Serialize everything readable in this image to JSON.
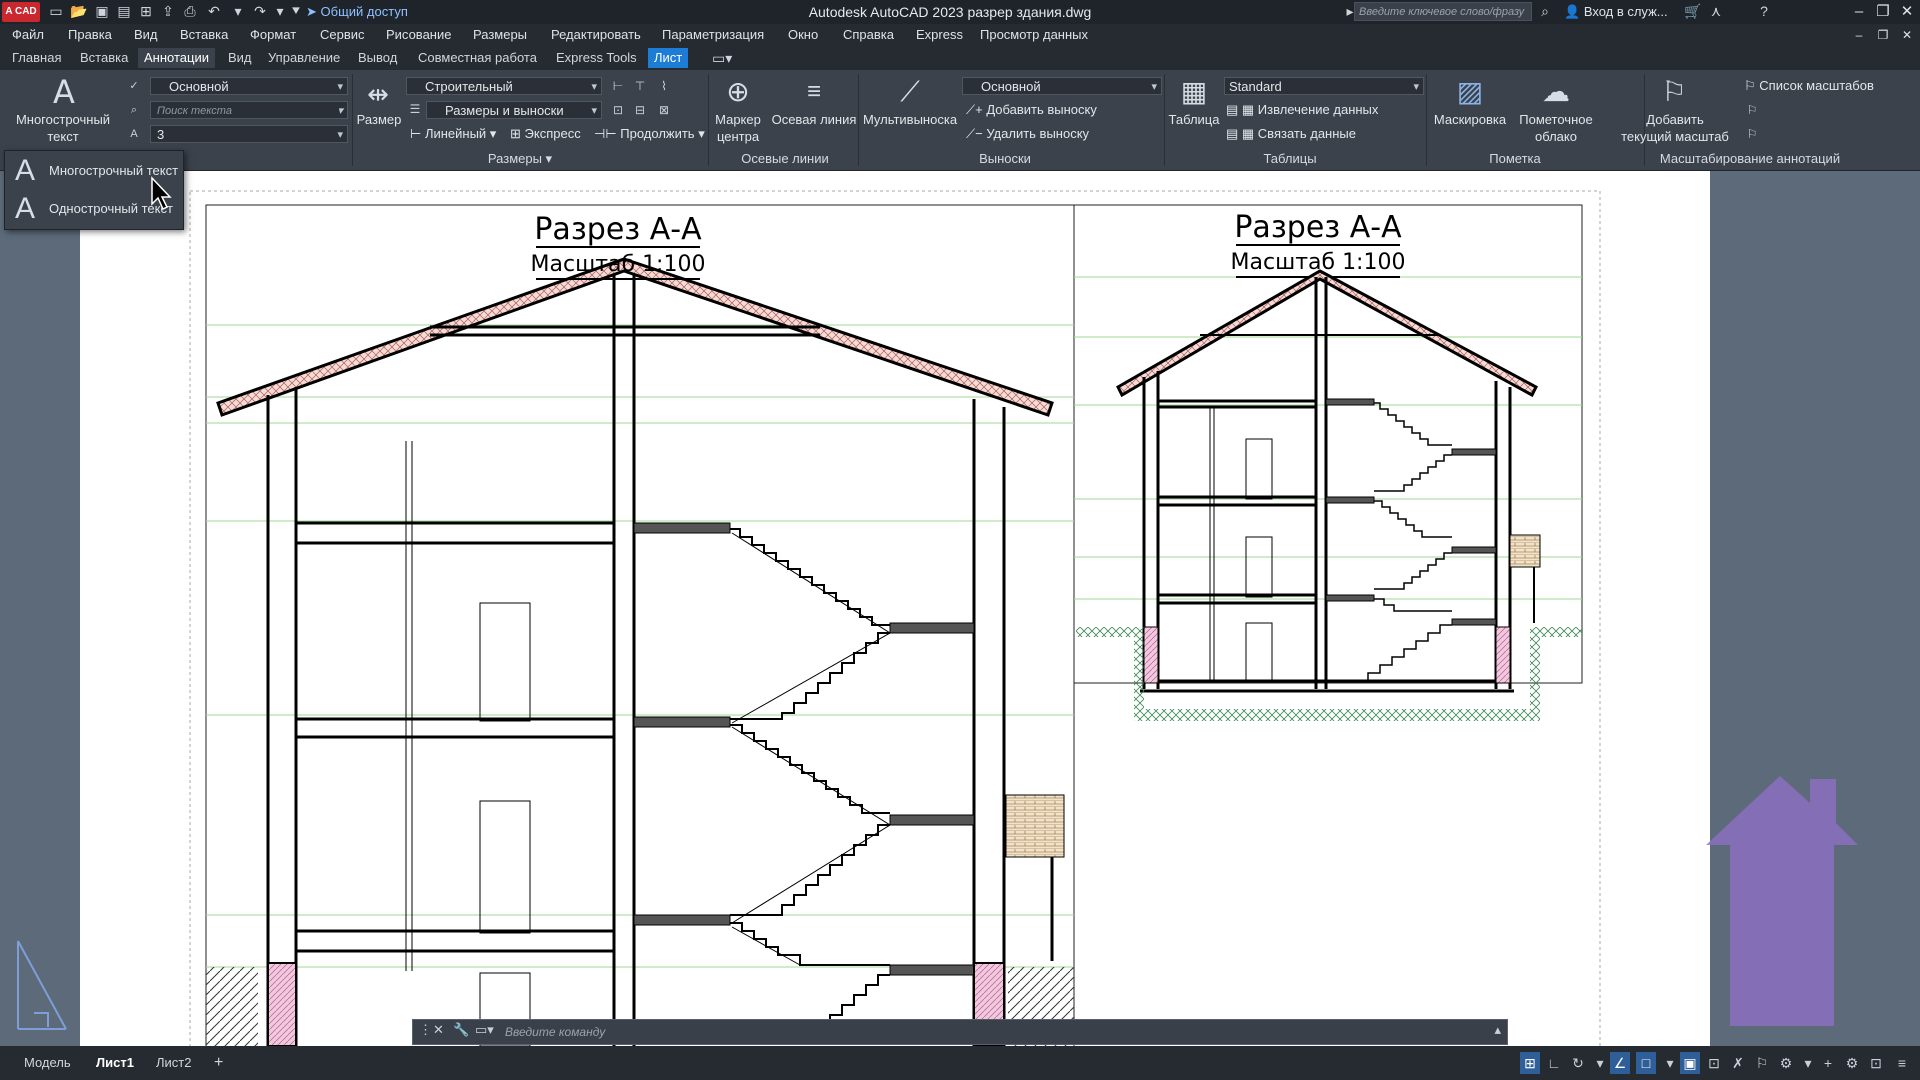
{
  "titlebar": {
    "logo": "A CAD",
    "share": "Общий доступ",
    "title": "Autodesk AutoCAD 2023   разрер здания.dwg",
    "search_placeholder": "Введите ключевое слово/фразу",
    "signin": "Вход в служ..."
  },
  "menubar": [
    "Файл",
    "Правка",
    "Вид",
    "Вставка",
    "Формат",
    "Сервис",
    "Рисование",
    "Размеры",
    "Редактировать",
    "Параметризация",
    "Окно",
    "Справка",
    "Express",
    "Просмотр данных"
  ],
  "ribbon_tabs": [
    "Главная",
    "Вставка",
    "Аннотации",
    "Вид",
    "Управление",
    "Вывод",
    "Совместная работа",
    "Express Tools",
    "Лист"
  ],
  "ribbon": {
    "mtext_label_1": "Многострочный",
    "mtext_label_2": "текст",
    "text_style": "Основной",
    "text_search": "Поиск текста",
    "text_height": "3",
    "dim_label": "Размер",
    "dim_style": "Строительный",
    "dim_layer": "Размеры и выноски",
    "linear": "Линейный",
    "express": "Экспресс",
    "continue": "Продолжить",
    "dims_panel": "Размеры",
    "center_mark_1": "Маркер",
    "center_mark_2": "центра",
    "centerline": "Осевая линия",
    "centerlines_panel": "Осевые линии",
    "mleader": "Мультивыноска",
    "leader_style": "Основной",
    "add_leader": "Добавить выноску",
    "remove_leader": "Удалить выноску",
    "leaders_panel": "Выноски",
    "table": "Таблица",
    "table_style": "Standard",
    "extract_data": "Извлечение данных",
    "link_data": "Связать данные",
    "tables_panel": "Таблицы",
    "wipeout": "Маскировка",
    "revcloud_1": "Пометочное",
    "revcloud_2": "облако",
    "markup_panel": "Пометка",
    "add_scale_1": "Добавить",
    "add_scale_2": "текущий масштаб",
    "scale_list": "Список масштабов",
    "scaling_panel": "Масштабирование аннотаций"
  },
  "dropdown": {
    "items": [
      "Многострочный текст",
      "Однострочный текст"
    ]
  },
  "drawing": {
    "left_title": "Разрез А-А",
    "left_scale": "Масштаб 1:100",
    "right_title": "Разрез А-А",
    "right_scale": "Масштаб 1:100"
  },
  "cmdline": {
    "placeholder": "Введите команду"
  },
  "statusbar": {
    "tabs": [
      "Модель",
      "Лист1",
      "Лист2"
    ],
    "add": "+"
  }
}
